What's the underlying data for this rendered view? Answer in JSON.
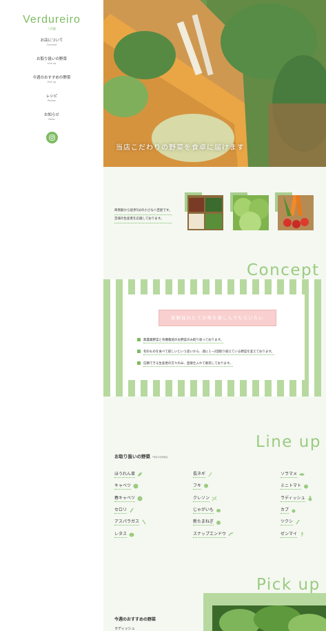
{
  "brand": {
    "logo": "Verdureiro",
    "logo_sub": "八百屋"
  },
  "nav": {
    "items": [
      {
        "ja": "お店について",
        "en": "Concept"
      },
      {
        "ja": "お取り扱いの野菜",
        "en": "Line up"
      },
      {
        "ja": "今週のおすすめの野菜",
        "en": "Pick up"
      },
      {
        "ja": "レシピ",
        "en": "Recipe"
      },
      {
        "ja": "お知らせ",
        "en": "News"
      }
    ],
    "instagram_icon": "instagram-icon"
  },
  "hero": {
    "tagline": "当店こだわりの野菜を食卓に届けます"
  },
  "intro": {
    "lines": [
      "目黒駅から徒歩5分の小さな八百屋です。",
      "宮城の生産者を応援しております。"
    ]
  },
  "concept": {
    "title": "Concept",
    "badge": "新鮮採れたての味を楽しんでもらいたい",
    "items": [
      "無農薬野菜と有機栽培のお野菜のみ取り扱っております。",
      "旬のものを食べて欲しいという思いから、週に１~2回取り揃えている野菜を変えております。",
      "信頼できる生産者の方々のみ、直接仕入れて販売しております。"
    ]
  },
  "lineup": {
    "title": "Line up",
    "heading": "お取り扱いの野菜",
    "note": "*8月10日時点",
    "columns": [
      [
        "ほうれん草",
        "キャベツ",
        "春キャベツ",
        "セロリ",
        "アスパラガス",
        "レタス"
      ],
      [
        "長ネギ",
        "フキ",
        "クレソン",
        "じゃがいも",
        "新たまねぎ",
        "スナップエンドウ"
      ],
      [
        "ソラマメ",
        "ミニトマト",
        "ラディッシュ",
        "カブ",
        "ツクシ",
        "ゼンマイ"
      ]
    ]
  },
  "pickup": {
    "title": "Pick up",
    "heading": "今週のおすすめの野菜",
    "sub": "ラディッシュ"
  },
  "colors": {
    "accent": "#7dbb61",
    "light_green": "#b7d99f",
    "badge_pink": "#f9cfcf",
    "bg": "#f4f8f1"
  }
}
